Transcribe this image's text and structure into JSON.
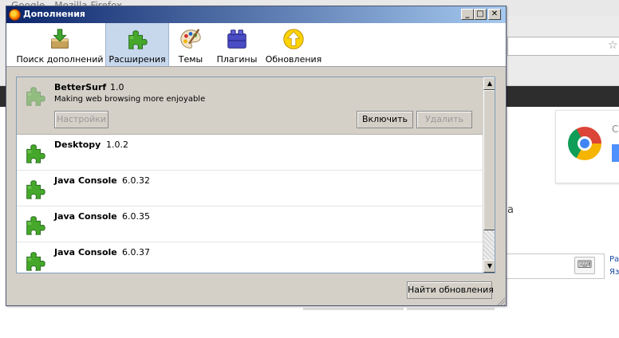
{
  "background": {
    "window_title": "Google - Mozilla Firefox",
    "partial_text": "а",
    "links": [
      "Ра",
      "Яз"
    ]
  },
  "dialog": {
    "title": "Дополнения",
    "window_buttons": {
      "minimize": "_",
      "maximize": "□",
      "close": "✕"
    },
    "tabs": [
      {
        "label": "Поиск дополнений",
        "icon": "download-box-icon",
        "selected": false
      },
      {
        "label": "Расширения",
        "icon": "puzzle-piece-icon",
        "selected": true
      },
      {
        "label": "Темы",
        "icon": "palette-icon",
        "selected": false
      },
      {
        "label": "Плагины",
        "icon": "plugin-blocks-icon",
        "selected": false
      },
      {
        "label": "Обновления",
        "icon": "update-arrow-icon",
        "selected": false
      }
    ],
    "extensions": [
      {
        "name": "BetterSurf",
        "version": "1.0",
        "description": "Making web browsing more enjoyable",
        "disabled": true,
        "selected": true,
        "buttons": {
          "settings": "Настройки",
          "enable": "Включить",
          "remove": "Удалить"
        }
      },
      {
        "name": "Desktopy",
        "version": "1.0.2"
      },
      {
        "name": "Java Console",
        "version": "6.0.32"
      },
      {
        "name": "Java Console",
        "version": "6.0.35"
      },
      {
        "name": "Java Console",
        "version": "6.0.37"
      }
    ],
    "find_updates_button": "Найти обновления"
  },
  "colors": {
    "titlebar_start": "#0a246a",
    "titlebar_end": "#a6caf0",
    "dialog_bg": "#d4d0c8",
    "selected_tab": "#c7d7ec",
    "puzzle_green": "#3f9b25"
  }
}
